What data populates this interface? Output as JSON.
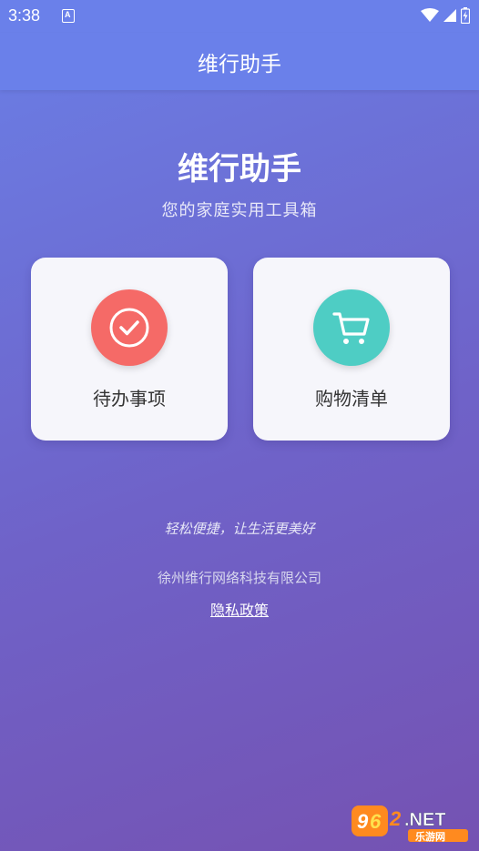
{
  "status_bar": {
    "time": "3:38"
  },
  "app_bar": {
    "title": "维行助手"
  },
  "hero": {
    "title": "维行助手",
    "subtitle": "您的家庭实用工具箱"
  },
  "cards": [
    {
      "label": "待办事项",
      "icon": "check-circle-icon",
      "color": "#f56a67"
    },
    {
      "label": "购物清单",
      "icon": "shopping-cart-icon",
      "color": "#4ecdc4"
    }
  ],
  "footer": {
    "slogan": "轻松便捷，让生活更美好",
    "company": "徐州维行网络科技有限公司",
    "privacy_link": "隐私政策"
  },
  "watermark": {
    "brand_number": "962",
    "brand_suffix": ".NET",
    "brand_cn": "乐游网"
  },
  "colors": {
    "app_bar": "#6a80ea",
    "gradient_start": "#6a7fe6",
    "gradient_end": "#7552b2",
    "card_bg": "#f6f6fb"
  }
}
